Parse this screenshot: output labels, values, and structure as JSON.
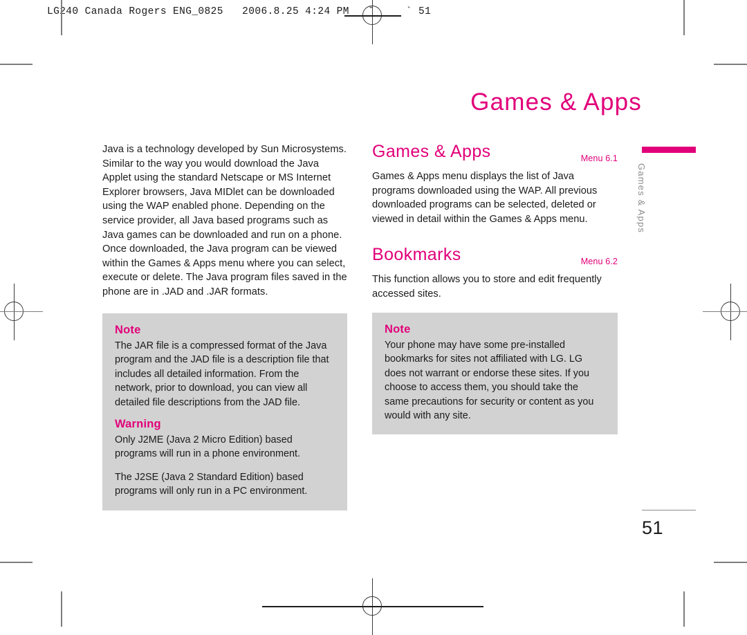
{
  "print_header": "LG240 Canada Rogers ENG_0825   2006.8.25 4:24 PM   ˘     ` 51",
  "page": {
    "running_title": "Games & Apps",
    "folio": "51",
    "thumb_tab_label": "Games & Apps",
    "accent_color": "#e2007a",
    "note_bg_color": "#d2d2d2",
    "tab_text_color": "#8c8c8c"
  },
  "left_column": {
    "intro_paragraph": "Java is a technology developed by Sun Microsystems. Similar to the way you would download the Java Applet using the standard Netscape or MS Internet Explorer browsers, Java MIDlet can be downloaded using the WAP enabled phone. Depending on the service provider, all Java based programs such as Java games can be downloaded and run on a phone. Once downloaded, the Java program can be viewed within the Games & Apps menu where you can select, execute or delete. The Java program files saved in the phone are in .JAD and .JAR formats.",
    "note_box": {
      "note_label": "Note",
      "note_text": "The JAR file is a compressed format of the Java program and the JAD file is a description file that includes all detailed information. From the network, prior to download, you can view all detailed file descriptions from the JAD file.",
      "warning_label": "Warning",
      "warning_text_1": "Only J2ME (Java 2 Micro Edition) based programs will run in a phone environment.",
      "warning_text_2": "The J2SE (Java 2 Standard Edition) based programs will only run in a PC environment."
    }
  },
  "right_column": {
    "sections": [
      {
        "heading": "Games & Apps",
        "menu_tag": "Menu 6.1",
        "body": "Games & Apps menu displays the list of Java programs downloaded using the WAP. All previous downloaded programs can be selected, deleted or viewed in detail within the Games & Apps menu."
      },
      {
        "heading": "Bookmarks",
        "menu_tag": "Menu 6.2",
        "body": "This function allows you to store and edit frequently accessed sites."
      }
    ],
    "note_box": {
      "note_label": "Note",
      "note_text": "Your phone may have some pre-installed bookmarks for sites not affiliated with LG. LG does not warrant or endorse these sites. If you choose to access them, you should take the same precautions for security or content as you would with any site."
    }
  }
}
